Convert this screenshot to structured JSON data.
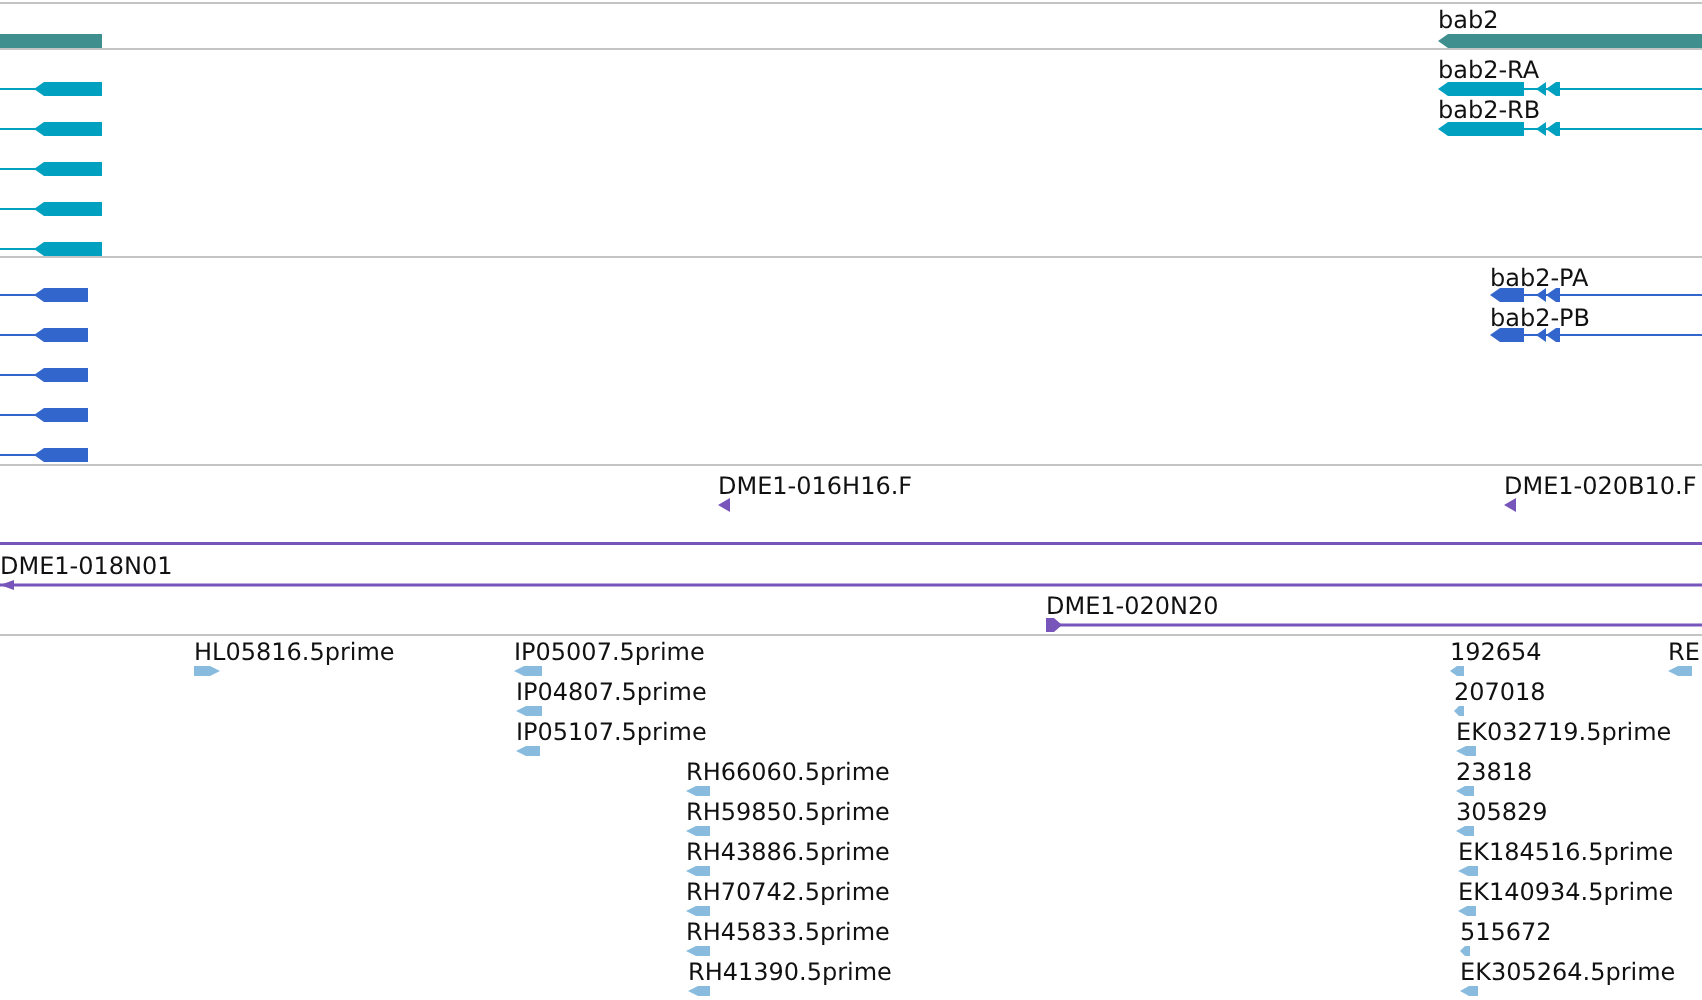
{
  "tracks": [
    {
      "kind": "gene",
      "features": [
        {
          "label": "bab2",
          "reverse": true
        }
      ]
    },
    {
      "kind": "transcript",
      "features": [
        {
          "label": "bab2-RA",
          "reverse": true
        },
        {
          "label": "bab2-RB",
          "reverse": true
        }
      ]
    },
    {
      "kind": "protein",
      "features": [
        {
          "label": "bab2-PA",
          "reverse": true
        },
        {
          "label": "bab2-PB",
          "reverse": true
        }
      ]
    },
    {
      "kind": "clone",
      "features": [
        {
          "label": "DME1-016H16.F",
          "reverse": true
        },
        {
          "label": "DME1-020B10.F",
          "reverse": true
        },
        {
          "label": "DME1-018N01",
          "reverse": true
        },
        {
          "label": "DME1-020N20",
          "reverse": false
        }
      ]
    },
    {
      "kind": "est",
      "features": [
        {
          "label": "HL05816.5prime",
          "reverse": false
        },
        {
          "label": "IP05007.5prime",
          "reverse": true
        },
        {
          "label": "IP04807.5prime",
          "reverse": true
        },
        {
          "label": "IP05107.5prime",
          "reverse": true
        },
        {
          "label": "RH66060.5prime",
          "reverse": true
        },
        {
          "label": "RH59850.5prime",
          "reverse": true
        },
        {
          "label": "RH43886.5prime",
          "reverse": true
        },
        {
          "label": "RH70742.5prime",
          "reverse": true
        },
        {
          "label": "RH45833.5prime",
          "reverse": true
        },
        {
          "label": "RH41390.5prime",
          "reverse": true
        },
        {
          "label": "192654",
          "reverse": true
        },
        {
          "label": "207018",
          "reverse": true
        },
        {
          "label": "EK032719.5prime",
          "reverse": true
        },
        {
          "label": "23818",
          "reverse": true
        },
        {
          "label": "305829",
          "reverse": true
        },
        {
          "label": "EK184516.5prime",
          "reverse": true
        },
        {
          "label": "EK140934.5prime",
          "reverse": true
        },
        {
          "label": "515672",
          "reverse": true
        },
        {
          "label": "EK305264.5prime",
          "reverse": true
        },
        {
          "label": "RE",
          "reverse": true
        }
      ]
    }
  ]
}
